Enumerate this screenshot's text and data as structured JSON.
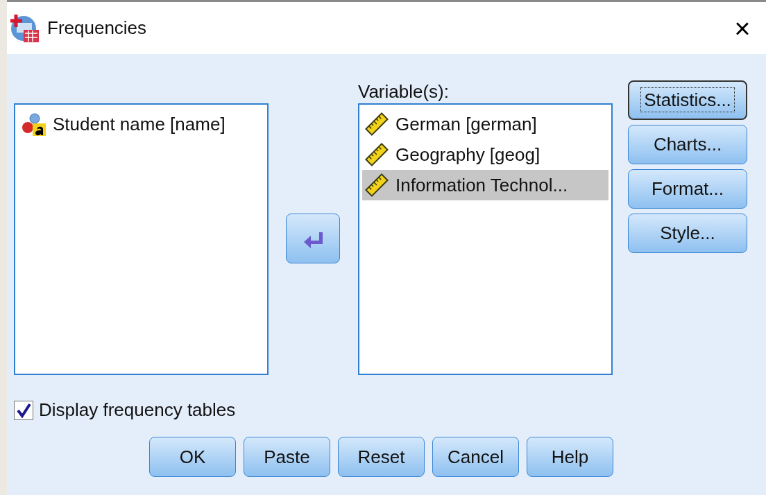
{
  "window": {
    "title": "Frequencies",
    "close": "×"
  },
  "source_list": {
    "items": [
      {
        "label": "Student name [name]",
        "kind": "nominal",
        "selected": false
      }
    ]
  },
  "target_list": {
    "label": "Variable(s):",
    "items": [
      {
        "label": "German [german]",
        "kind": "scale",
        "selected": false
      },
      {
        "label": "Geography [geog]",
        "kind": "scale",
        "selected": false
      },
      {
        "label": "Information Technol...",
        "kind": "scale",
        "selected": true
      }
    ]
  },
  "side_buttons": [
    {
      "label": "Statistics...",
      "focused": true
    },
    {
      "label": "Charts...",
      "focused": false
    },
    {
      "label": "Format...",
      "focused": false
    },
    {
      "label": "Style...",
      "focused": false
    }
  ],
  "checkbox": {
    "label": "Display frequency tables",
    "checked": true
  },
  "buttons": [
    {
      "label": "OK"
    },
    {
      "label": "Paste"
    },
    {
      "label": "Reset"
    },
    {
      "label": "Cancel"
    },
    {
      "label": "Help"
    }
  ]
}
